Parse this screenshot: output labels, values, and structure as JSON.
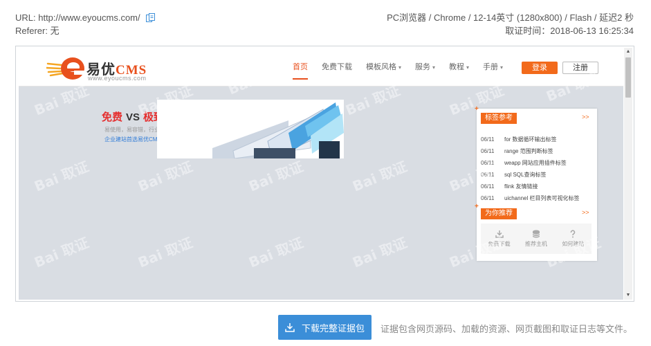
{
  "meta": {
    "url_label": "URL: http://www.eyoucms.com/",
    "referer_label": "Referer: 无",
    "device_info": "PC浏览器 / Chrome / 12-14英寸 (1280x800) / Flash / 延迟2 秒",
    "capture_time": "取证时间：2018-06-13 16:25:34"
  },
  "site": {
    "logo_name": "易优",
    "logo_cms": "CMS",
    "logo_url": "www.eyoucms.com",
    "nav": [
      {
        "label": "首页",
        "active": true,
        "dropdown": false
      },
      {
        "label": "免费下载",
        "active": false,
        "dropdown": false
      },
      {
        "label": "模板风格",
        "active": false,
        "dropdown": true
      },
      {
        "label": "服务",
        "active": false,
        "dropdown": true
      },
      {
        "label": "教程",
        "active": false,
        "dropdown": true
      },
      {
        "label": "手册",
        "active": false,
        "dropdown": true
      }
    ],
    "login_label": "登录",
    "register_label": "注册",
    "banner": {
      "headline_left": "免费",
      "headline_vs": "VS",
      "headline_right": "极致的好!",
      "sub": "易使用，易容错，行业中安全免费",
      "link": "企业建站首选易优CMS"
    },
    "panel": {
      "tags_title": "标签参考",
      "more": ">>",
      "tags": [
        {
          "date": "06/11",
          "title": "for 数据循环输出标签"
        },
        {
          "date": "06/11",
          "title": "range 范围判断标签"
        },
        {
          "date": "06/11",
          "title": "weapp 网站应用插件标签"
        },
        {
          "date": "06/11",
          "title": "sql SQL查询标签"
        },
        {
          "date": "06/11",
          "title": "flink 友情链接"
        },
        {
          "date": "06/11",
          "title": "uichannel 栏目列表可视化标签"
        }
      ],
      "recommend_title": "为你推荐",
      "recommend": [
        {
          "label": "免费下载",
          "icon": "download-icon"
        },
        {
          "label": "推荐主机",
          "icon": "database-icon"
        },
        {
          "label": "如何建站",
          "icon": "question-icon"
        }
      ]
    },
    "watermark_text": "Bai 取证"
  },
  "bottom": {
    "download_label": "下载完整证据包",
    "note": "证据包含网页源码、加载的资源、网页截图和取证日志等文件。"
  },
  "colors": {
    "accent": "#f26a1b",
    "primary_button": "#3b8ed8",
    "page_bg": "#d9dde3"
  }
}
